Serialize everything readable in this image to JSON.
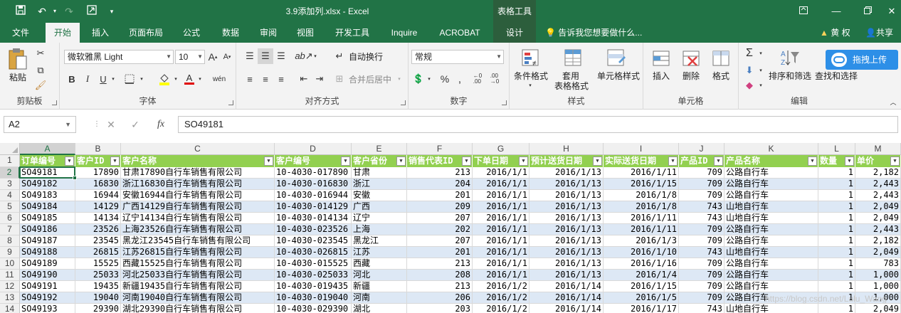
{
  "window": {
    "title": "3.9添加列.xlsx - Excel",
    "context_title": "表格工具",
    "qa_icons": [
      "save-icon",
      "undo-icon",
      "redo-icon",
      "touch-mode-icon",
      "customize-qat-icon"
    ],
    "controls": [
      "minimize-icon",
      "restore-icon",
      "close-icon",
      "ribbon-display-icon"
    ]
  },
  "tabs": [
    {
      "label": "文件",
      "active": false,
      "ctx": false
    },
    {
      "label": "开始",
      "active": true,
      "ctx": false
    },
    {
      "label": "插入",
      "active": false,
      "ctx": false
    },
    {
      "label": "页面布局",
      "active": false,
      "ctx": false
    },
    {
      "label": "公式",
      "active": false,
      "ctx": false
    },
    {
      "label": "数据",
      "active": false,
      "ctx": false
    },
    {
      "label": "审阅",
      "active": false,
      "ctx": false
    },
    {
      "label": "视图",
      "active": false,
      "ctx": false
    },
    {
      "label": "开发工具",
      "active": false,
      "ctx": false
    },
    {
      "label": "Inquire",
      "active": false,
      "ctx": false
    },
    {
      "label": "ACROBAT",
      "active": false,
      "ctx": false
    },
    {
      "label": "设计",
      "active": false,
      "ctx": true
    }
  ],
  "tellme": "告诉我您想要做什么...",
  "user": "黄 权",
  "share": "共享",
  "ribbon": {
    "clipboard": {
      "label": "剪贴板",
      "paste": "粘贴"
    },
    "font": {
      "label": "字体",
      "name": "微软雅黑 Light",
      "size": "10"
    },
    "alignment": {
      "label": "对齐方式",
      "wrap": "自动换行",
      "merge": "合并后居中"
    },
    "number": {
      "label": "数字",
      "format": "常规"
    },
    "styles": {
      "label": "样式",
      "cond": "条件格式",
      "table_line1": "套用",
      "table_line2": "表格格式",
      "cell_styles": "单元格样式"
    },
    "cells": {
      "label": "单元格",
      "insert": "插入",
      "delete": "删除",
      "format": "格式"
    },
    "editing": {
      "label": "编辑",
      "sort": "排序和筛选",
      "find": "查找和选择"
    },
    "cloud": "拖拽上传"
  },
  "formula_bar": {
    "name": "A2",
    "value": "SO49181",
    "fx": "fx"
  },
  "columns": [
    "A",
    "B",
    "C",
    "D",
    "E",
    "F",
    "G",
    "H",
    "I",
    "J",
    "K",
    "L",
    "M"
  ],
  "headers": [
    "订单编号",
    "客户ID",
    "客户名称",
    "客户编号",
    "客户省份",
    "销售代表ID",
    "下单日期",
    "预计送货日期",
    "实际送货日期",
    "产品ID",
    "产品名称",
    "数量",
    "单价"
  ],
  "rows": [
    {
      "n": "2",
      "v": [
        "SO49181",
        "17890",
        "甘肃17890自行车销售有限公司",
        "10-4030-017890",
        "甘肃",
        "213",
        "2016/1/1",
        "2016/1/13",
        "2016/1/11",
        "709",
        "公路自行车",
        "1",
        "2,182"
      ]
    },
    {
      "n": "3",
      "v": [
        "SO49182",
        "16830",
        "浙江16830自行车销售有限公司",
        "10-4030-016830",
        "浙江",
        "204",
        "2016/1/1",
        "2016/1/13",
        "2016/1/15",
        "709",
        "公路自行车",
        "1",
        "2,443"
      ]
    },
    {
      "n": "4",
      "v": [
        "SO49183",
        "16944",
        "安徽16944自行车销售有限公司",
        "10-4030-016944",
        "安徽",
        "201",
        "2016/1/1",
        "2016/1/13",
        "2016/1/8",
        "709",
        "公路自行车",
        "1",
        "2,443"
      ]
    },
    {
      "n": "5",
      "v": [
        "SO49184",
        "14129",
        "广西14129自行车销售有限公司",
        "10-4030-014129",
        "广西",
        "209",
        "2016/1/1",
        "2016/1/13",
        "2016/1/8",
        "743",
        "山地自行车",
        "1",
        "2,049"
      ]
    },
    {
      "n": "6",
      "v": [
        "SO49185",
        "14134",
        "辽宁14134自行车销售有限公司",
        "10-4030-014134",
        "辽宁",
        "207",
        "2016/1/1",
        "2016/1/13",
        "2016/1/11",
        "743",
        "山地自行车",
        "1",
        "2,049"
      ]
    },
    {
      "n": "7",
      "v": [
        "SO49186",
        "23526",
        "上海23526自行车销售有限公司",
        "10-4030-023526",
        "上海",
        "202",
        "2016/1/1",
        "2016/1/13",
        "2016/1/11",
        "709",
        "公路自行车",
        "1",
        "2,443"
      ]
    },
    {
      "n": "8",
      "v": [
        "SO49187",
        "23545",
        "黑龙江23545自行车销售有限公司",
        "10-4030-023545",
        "黑龙江",
        "207",
        "2016/1/1",
        "2016/1/13",
        "2016/1/3",
        "709",
        "公路自行车",
        "1",
        "2,182"
      ]
    },
    {
      "n": "9",
      "v": [
        "SO49188",
        "26815",
        "江苏26815自行车销售有限公司",
        "10-4030-026815",
        "江苏",
        "201",
        "2016/1/1",
        "2016/1/13",
        "2016/1/10",
        "743",
        "山地自行车",
        "1",
        "2,049"
      ]
    },
    {
      "n": "10",
      "v": [
        "SO49189",
        "15525",
        "西藏15525自行车销售有限公司",
        "10-4030-015525",
        "西藏",
        "213",
        "2016/1/1",
        "2016/1/13",
        "2016/1/16",
        "709",
        "公路自行车",
        "1",
        "783"
      ]
    },
    {
      "n": "11",
      "v": [
        "SO49190",
        "25033",
        "河北25033自行车销售有限公司",
        "10-4030-025033",
        "河北",
        "208",
        "2016/1/1",
        "2016/1/13",
        "2016/1/4",
        "709",
        "公路自行车",
        "1",
        "1,000"
      ]
    },
    {
      "n": "12",
      "v": [
        "SO49191",
        "19435",
        "新疆19435自行车销售有限公司",
        "10-4030-019435",
        "新疆",
        "213",
        "2016/1/2",
        "2016/1/14",
        "2016/1/15",
        "709",
        "公路自行车",
        "1",
        "1,000"
      ]
    },
    {
      "n": "13",
      "v": [
        "SO49192",
        "19040",
        "河南19040自行车销售有限公司",
        "10-4030-019040",
        "河南",
        "206",
        "2016/1/2",
        "2016/1/14",
        "2016/1/5",
        "709",
        "公路自行车",
        "1",
        "1,000"
      ]
    },
    {
      "n": "14",
      "v": [
        "SO49193",
        "29390",
        "湖北29390自行车销售有限公司",
        "10-4030-029390",
        "湖北",
        "203",
        "2016/1/2",
        "2016/1/14",
        "2016/1/17",
        "743",
        "山地自行车",
        "1",
        "2,049"
      ]
    }
  ],
  "watermark": "https://blog.csdn.net/Lulu_Wang"
}
